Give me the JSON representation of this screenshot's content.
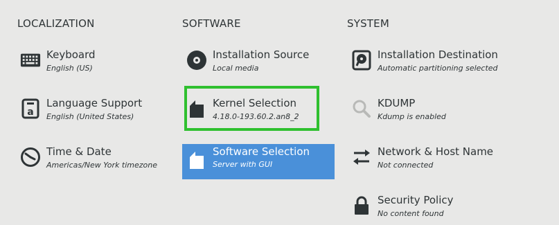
{
  "columns": {
    "localization": {
      "heading": "LOCALIZATION"
    },
    "software": {
      "heading": "SOFTWARE"
    },
    "system": {
      "heading": "SYSTEM"
    }
  },
  "spokes": {
    "keyboard": {
      "title": "Keyboard",
      "status": "English (US)",
      "icon": "keyboard-icon"
    },
    "language": {
      "title": "Language Support",
      "status": "English (United States)",
      "icon": "language-icon"
    },
    "time": {
      "title": "Time & Date",
      "status": "Americas/New York timezone",
      "icon": "clock-icon"
    },
    "source": {
      "title": "Installation Source",
      "status": "Local media",
      "icon": "disc-icon"
    },
    "kernel": {
      "title": "Kernel Selection",
      "status": "4.18.0-193.60.2.an8_2",
      "icon": "package-icon"
    },
    "software": {
      "title": "Software Selection",
      "status": "Server with GUI",
      "icon": "package-icon"
    },
    "destination": {
      "title": "Installation Destination",
      "status": "Automatic partitioning selected",
      "icon": "harddisk-icon"
    },
    "kdump": {
      "title": "KDUMP",
      "status": "Kdump is enabled",
      "icon": "magnifier-icon"
    },
    "network": {
      "title": "Network & Host Name",
      "status": "Not connected",
      "icon": "network-arrows-icon"
    },
    "security": {
      "title": "Security Policy",
      "status": "No content found",
      "icon": "lock-icon"
    }
  },
  "colors": {
    "background": "#e8e8e7",
    "selected": "#4a90d9",
    "highlight": "#2fc02f",
    "text": "#2e3436"
  }
}
